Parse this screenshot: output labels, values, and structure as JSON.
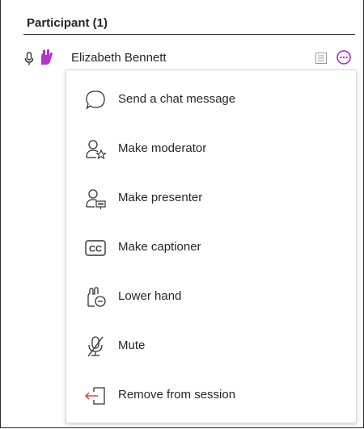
{
  "participants_header": "Participant (1)",
  "participant": {
    "name": "Elizabeth Bennett"
  },
  "colors": {
    "accent": "#a21cc6",
    "hand": "#b231d1",
    "danger": "#d93a3a",
    "text": "#262626",
    "icon_gray": "#7a7a7a"
  },
  "icons": {
    "mic": "microphone-icon",
    "hand": "raised-hand-icon",
    "list": "list-icon",
    "more": "more-options-icon"
  },
  "menu": {
    "items": [
      {
        "label": "Send a chat message",
        "icon": "chat-bubble-icon"
      },
      {
        "label": "Make moderator",
        "icon": "moderator-icon"
      },
      {
        "label": "Make presenter",
        "icon": "presenter-icon"
      },
      {
        "label": "Make captioner",
        "icon": "captioner-icon"
      },
      {
        "label": "Lower hand",
        "icon": "lower-hand-icon"
      },
      {
        "label": "Mute",
        "icon": "mute-icon"
      },
      {
        "label": "Remove from session",
        "icon": "remove-icon"
      }
    ]
  }
}
